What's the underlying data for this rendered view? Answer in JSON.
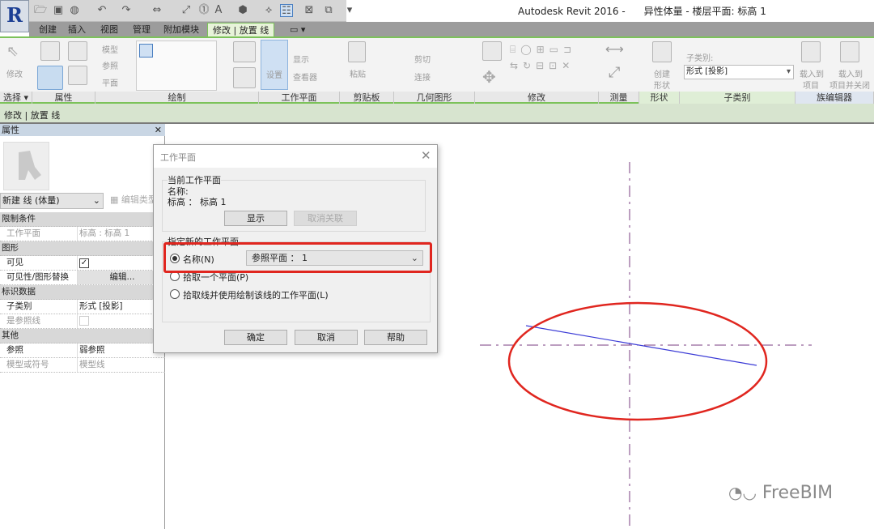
{
  "app": {
    "title": "Autodesk Revit 2016 -      异性体量 - 楼层平面: 标高 1",
    "logo": "R"
  },
  "quick_access": {
    "icons": [
      "open-icon",
      "save-icon",
      "sync-icon",
      "undo-icon",
      "redo-icon",
      "measure-icon",
      "dimension-icon",
      "tag-icon",
      "text-icon",
      "3d-view-icon",
      "section-icon",
      "thin-lines-icon",
      "close-hidden-icon",
      "switch-windows-icon",
      "customize-icon"
    ]
  },
  "tabs": [
    {
      "label": "创建"
    },
    {
      "label": "插入"
    },
    {
      "label": "视图"
    },
    {
      "label": "管理"
    },
    {
      "label": "附加模块"
    },
    {
      "label": "修改 | 放置 线",
      "active": true
    },
    {
      "label": "▭ ▾"
    }
  ],
  "ribbon": {
    "select": {
      "modify": "修改",
      "label": "选择 ▾"
    },
    "properties": {
      "label": "属性"
    },
    "draw": {
      "model": "模型",
      "reference": "参照",
      "plane": "平面",
      "label": "绘制"
    },
    "workplane": {
      "set": "设置",
      "show": "显示",
      "viewer": "查看器",
      "label": "工作平面"
    },
    "clipboard": {
      "paste": "粘贴",
      "label": "剪贴板"
    },
    "geometry": {
      "cut": "剪切",
      "join": "连接",
      "label": "几何图形"
    },
    "modify": {
      "label": "修改"
    },
    "measure": {
      "label": "测量"
    },
    "form": {
      "create": "创建",
      "create2": "形状",
      "label": "形状"
    },
    "subcategory": {
      "caption": "子类别:",
      "value": "形式 [投影]",
      "label": "子类别"
    },
    "family_editor": {
      "load1a": "载入到",
      "load1b": "项目",
      "load2a": "载入到",
      "load2b": "项目并关闭",
      "label": "族编辑器"
    }
  },
  "context_bar": "修改 | 放置 线",
  "properties_panel": {
    "title": "属性",
    "type": "新建 线 (体量)",
    "edit_type": "编辑类型",
    "rows": [
      {
        "group": "限制条件"
      },
      {
        "key": "工作平面",
        "value": "标高 : 标高 1",
        "disabled": true
      },
      {
        "group": "图形"
      },
      {
        "key": "可见",
        "checkbox": true,
        "checked": true
      },
      {
        "key": "可见性/图形替换",
        "button": "编辑..."
      },
      {
        "group": "标识数据"
      },
      {
        "key": "子类别",
        "value": "形式 [投影]"
      },
      {
        "key": "是参照线",
        "checkbox": true,
        "checked": false,
        "disabled": true
      },
      {
        "group": "其他"
      },
      {
        "key": "参照",
        "value": "弱参照"
      },
      {
        "key": "模型或符号",
        "value": "模型线",
        "disabled": true
      }
    ]
  },
  "dialog": {
    "title": "工作平面",
    "current_group": "当前工作平面",
    "name_label": "名称:",
    "name_value": "标高 ： 标高 1",
    "show": "显示",
    "dissociate": "取消关联",
    "new_group": "指定新的工作平面",
    "options": [
      {
        "label": "名称(N)",
        "selected": true
      },
      {
        "label": "拾取一个平面(P)",
        "selected": false
      },
      {
        "label": "拾取线并使用绘制该线的工作平面(L)",
        "selected": false
      }
    ],
    "name_combo": "参照平面 ： 1",
    "ok": "确定",
    "cancel": "取消",
    "help": "帮助"
  },
  "watermark": "FreeBIM",
  "colors": {
    "accent_green": "#7cc25a",
    "highlight_red": "#e0261f",
    "ref_plane": "#7a3d80",
    "model_line": "#3b3bd6"
  }
}
